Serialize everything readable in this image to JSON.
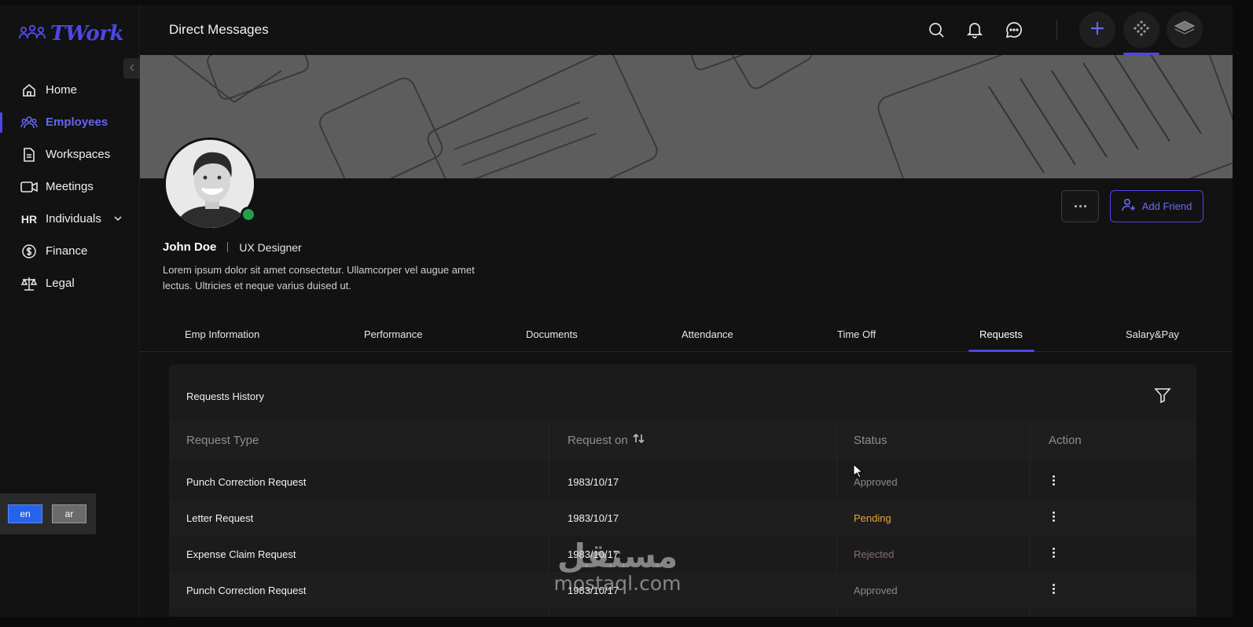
{
  "app": {
    "logo_text": "TWork"
  },
  "header": {
    "title": "Direct Messages"
  },
  "sidebar": {
    "items": [
      {
        "label": "Home",
        "icon": "home-icon"
      },
      {
        "label": "Employees",
        "icon": "users-icon",
        "active": true
      },
      {
        "label": "Workspaces",
        "icon": "document-icon"
      },
      {
        "label": "Meetings",
        "icon": "video-icon"
      },
      {
        "label": "Individuals",
        "icon": "hr-icon",
        "prefix": "HR"
      },
      {
        "label": "Finance",
        "icon": "dollar-icon"
      },
      {
        "label": "Legal",
        "icon": "scale-icon"
      }
    ]
  },
  "language": {
    "en": "en",
    "ar": "ar",
    "selected": "en"
  },
  "profile": {
    "name": "John Doe",
    "role": "UX Designer",
    "bio": "Lorem ipsum dolor sit amet consectetur. Ullamcorper vel augue amet lectus. Ultricies et neque varius duised ut.",
    "status": "online",
    "add_friend_label": "Add Friend"
  },
  "tabs": [
    {
      "label": "Emp Information"
    },
    {
      "label": "Performance"
    },
    {
      "label": "Documents"
    },
    {
      "label": "Attendance"
    },
    {
      "label": "Time Off"
    },
    {
      "label": "Requests",
      "active": true
    },
    {
      "label": "Salary&Pay"
    }
  ],
  "requests": {
    "title": "Requests History",
    "columns": {
      "type": "Request Type",
      "date": "Request on",
      "status": "Status",
      "action": "Action"
    },
    "rows": [
      {
        "type": "Punch Correction Request",
        "date": "1983/10/17",
        "status": "Approved"
      },
      {
        "type": "Letter Request",
        "date": "1983/10/17",
        "status": "Pending"
      },
      {
        "type": "Expense Claim Request",
        "date": "1983/10/17",
        "status": "Rejected"
      },
      {
        "type": "Punch Correction Request",
        "date": "1983/10/17",
        "status": "Approved"
      }
    ]
  },
  "watermark": {
    "arabic": "مستقل",
    "latin": "mostaql.com"
  },
  "colors": {
    "accent": "#4f46e5",
    "pending": "#e8a33d",
    "online": "#22a04b"
  }
}
